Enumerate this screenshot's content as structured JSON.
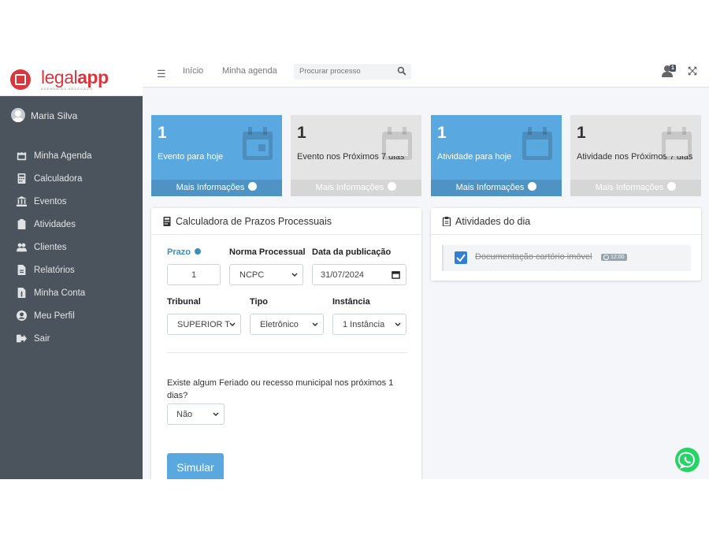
{
  "brand": {
    "name_part1": "legal",
    "name_part2": "app",
    "tagline": "AGENDA DO ADVOGADO"
  },
  "user": {
    "name": "Maria Silva"
  },
  "sidebar": {
    "items": [
      {
        "label": "Minha Agenda",
        "icon": "calendar-icon"
      },
      {
        "label": "Calculadora",
        "icon": "calculator-icon"
      },
      {
        "label": "Eventos",
        "icon": "bank-icon"
      },
      {
        "label": "Atividades",
        "icon": "clipboard-icon"
      },
      {
        "label": "Clientes",
        "icon": "users-icon"
      },
      {
        "label": "Relatórios",
        "icon": "file-icon"
      },
      {
        "label": "Minha Conta",
        "icon": "file-dollar-icon"
      },
      {
        "label": "Meu Perfil",
        "icon": "user-circle-icon"
      },
      {
        "label": "Sair",
        "icon": "sign-out-icon"
      }
    ]
  },
  "topbar": {
    "links": [
      "Início",
      "Minha agenda"
    ],
    "search_placeholder": "Procurar processo",
    "notification_count": "1"
  },
  "info_boxes": [
    {
      "number": "1",
      "label": "Evento para hoje",
      "footer": "Mais Informações",
      "color": "#5aa8e0"
    },
    {
      "number": "1",
      "label": "Evento nos Próximos 7 dias",
      "footer": "Mais Informações",
      "color": "#e4e4e4"
    },
    {
      "number": "1",
      "label": "Atividade para hoje",
      "footer": "Mais Informações",
      "color": "#5aa8e0"
    },
    {
      "number": "1",
      "label": "Atividade nos Próximos 7 dias",
      "footer": "Mais Informações",
      "color": "#e4e4e4"
    }
  ],
  "calculator": {
    "title": "Calculadora de Prazos Processuais",
    "prazo_label": "Prazo",
    "prazo_value": "1",
    "norma_label": "Norma Processual",
    "norma_value": "NCPC",
    "data_label": "Data da publicação",
    "data_value": "31/07/2024",
    "tribunal_label": "Tribunal",
    "tribunal_value": "SUPERIOR T",
    "tipo_label": "Tipo",
    "tipo_value": "Eletrônico",
    "instancia_label": "Instância",
    "instancia_value": "1 Instância",
    "feriado_question": "Existe algum Feriado ou recesso municipal nos próximos 1 dias?",
    "feriado_value": "Não",
    "submit_label": "Simular"
  },
  "activities": {
    "title": "Atividades do dia",
    "items": [
      {
        "text": "Documentação cartório imóvel",
        "time": "12:00",
        "done": true
      }
    ]
  }
}
